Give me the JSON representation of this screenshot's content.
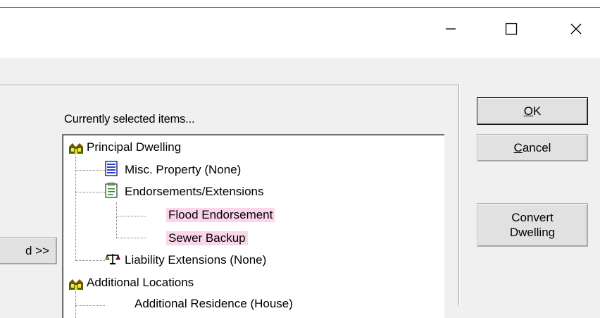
{
  "window": {
    "caption_buttons": [
      "minimize",
      "maximize",
      "close"
    ]
  },
  "left_button": {
    "label": "d >>"
  },
  "selected_panel": {
    "label": "Currently selected items...",
    "tree": [
      {
        "label": "Principal Dwelling",
        "icon": "house-icon",
        "level": 0
      },
      {
        "label": "Misc. Property (None)",
        "icon": "document-list-icon",
        "level": 1
      },
      {
        "label": "Endorsements/Extensions",
        "icon": "document-icon",
        "level": 1
      },
      {
        "label": "Flood Endorsement",
        "icon": "",
        "level": 2,
        "highlight": true
      },
      {
        "label": "Sewer Backup",
        "icon": "",
        "level": 2,
        "highlight": true
      },
      {
        "label": "Liability Extensions (None)",
        "icon": "scales-icon",
        "level": 1
      },
      {
        "label": "Additional Locations",
        "icon": "house-icon",
        "level": 0
      },
      {
        "label": "Additional Residence (House)",
        "icon": "",
        "level": 1
      }
    ],
    "highlight_color": "#fbd6ea"
  },
  "buttons": {
    "ok": {
      "mnemonic": "O",
      "rest": "K"
    },
    "cancel": {
      "mnemonic": "C",
      "rest": "ancel"
    },
    "convert_line1": "Convert",
    "convert_line2": "Dwelling"
  }
}
